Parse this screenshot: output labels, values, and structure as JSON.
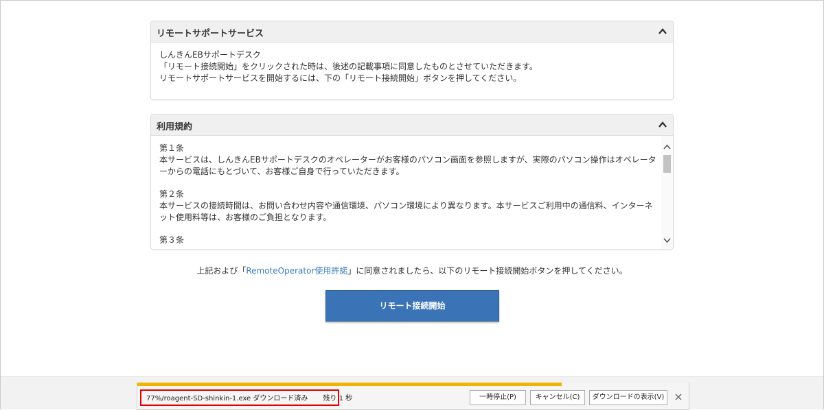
{
  "remote_panel": {
    "title": "リモートサポートサービス",
    "lines": [
      "しんきんEBサポートデスク",
      "「リモート接続開始」をクリックされた時は、後述の記載事項に同意したものとさせていただきます。",
      "リモートサポートサービスを開始するには、下の「リモート接続開始」ボタンを押してください。"
    ]
  },
  "terms_panel": {
    "title": "利用規約",
    "articles": [
      {
        "heading": "第１条",
        "body": "本サービスは、しんきんEBサポートデスクのオペレーターがお客様のパソコン画面を参照しますが、実際のパソコン操作はオペレーターからの電話にもとづいて、お客様ご自身で行っていただきます。"
      },
      {
        "heading": "第２条",
        "body": "本サービスの接続時間は、お問い合わせ内容や通信環境、パソコン環境により異なります。本サービスご利用中の通信料、インターネット使用料等は、お客様のご負担となります。"
      },
      {
        "heading": "第３条",
        "body": ""
      }
    ]
  },
  "agree": {
    "prefix": "上記および「",
    "link": "RemoteOperator使用許諾",
    "suffix": "」に同意されましたら、以下のリモート接続開始ボタンを押してください。"
  },
  "connect_button": "リモート接続開始",
  "download_bar": {
    "progress_percent": 77,
    "status": "77%/roagent-SD-shinkin-1.exe ダウンロード済み",
    "remaining": "残り 1 秒",
    "pause": "一時停止(P)",
    "cancel": "キャンセル(C)",
    "show": "ダウンロードの表示(V)",
    "close": "×"
  },
  "colors": {
    "button_blue": "#3b74b6",
    "link_blue": "#3a7bbf",
    "progress_yellow": "#f0b400",
    "highlight_red": "#e00000"
  }
}
